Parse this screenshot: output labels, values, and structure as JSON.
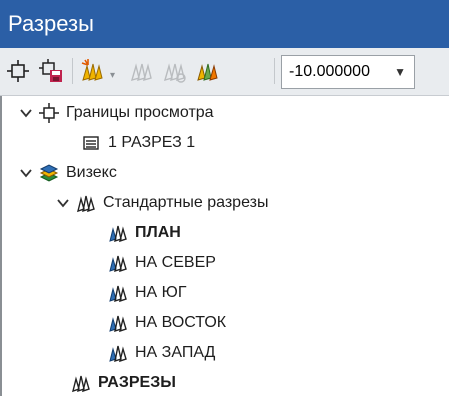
{
  "panel": {
    "title": "Разрезы"
  },
  "toolbar": {
    "combo_value": "-10.000000"
  },
  "tree": {
    "items": [
      {
        "label": "Границы просмотра"
      },
      {
        "label": "1 РАЗРЕЗ 1"
      },
      {
        "label": "Визекс"
      },
      {
        "label": "Стандартные разрезы"
      },
      {
        "label": "ПЛАН"
      },
      {
        "label": "НА СЕВЕР"
      },
      {
        "label": "НА ЮГ"
      },
      {
        "label": "НА ВОСТОК"
      },
      {
        "label": "НА ЗАПАД"
      },
      {
        "label": "РАЗРЕЗЫ"
      }
    ]
  },
  "colors": {
    "titlebar": "#2b5fa6",
    "toolbar_bg": "#e9ecef",
    "section_icon": "#2f6fb5",
    "accent_yellow": "#f0b400"
  },
  "icons": {
    "view-bounds": "view-bounds-icon",
    "list": "list-icon",
    "layers": "layers-icon",
    "sections": "sections-icon"
  }
}
